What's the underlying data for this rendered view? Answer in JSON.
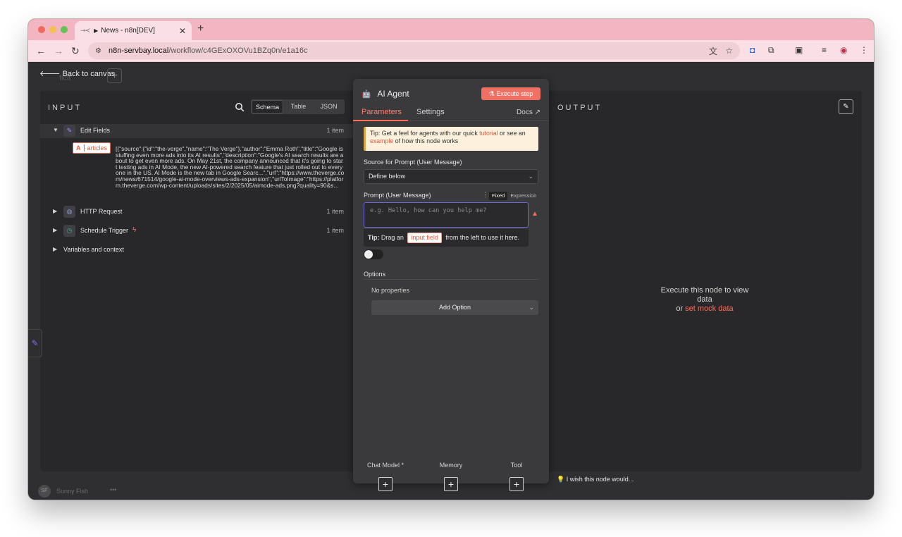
{
  "browser": {
    "tab_title": "News - n8n[DEV]",
    "tab_favicon": "⊸≺",
    "url_host": "n8n-servbay.local",
    "url_path": "/workflow/c4GExOXOVu1BZq0n/e1a16c"
  },
  "app": {
    "back_label": "Back to canvas",
    "ghost_node_name": "ficlt"
  },
  "input_panel": {
    "title": "INPUT",
    "view_modes": [
      "Schema",
      "Table",
      "JSON"
    ],
    "active_view": "Schema",
    "nodes": [
      {
        "name": "Edit Fields",
        "count": "1 item",
        "expanded": true
      },
      {
        "name": "HTTP Request",
        "count": "1 item"
      },
      {
        "name": "Schedule Trigger",
        "count": "1 item"
      },
      {
        "name": "Variables and context"
      }
    ],
    "field_type_letter": "A",
    "field_name": "articles",
    "field_value": "[{\"source\":{\"id\":\"the-verge\",\"name\":\"The Verge\"},\"author\":\"Emma Roth\",\"title\":\"Google is stuffing even more ads into its AI results\",\"description\":\"Google's AI search results are about to get even more ads. On May 21st, the company announced that it's going to start testing ads in AI Mode, the new AI-powered search feature that just rolled out to everyone in the US. AI Mode is the new tab in Google Searc...\",\"url\":\"https://www.theverge.com/news/671514/google-ai-mode-overviews-ads-expansion\",\"urlToImage\":\"https://platform.theverge.com/wp-content/uploads/sites/2/2025/05/aimode-ads.png?quality=90&s..."
  },
  "node_panel": {
    "title": "AI Agent",
    "execute_label": "Execute step",
    "tabs": [
      "Parameters",
      "Settings"
    ],
    "docs_label": "Docs",
    "notice_prefix": "Tip: Get a feel for agents with our quick ",
    "notice_link1": "tutorial",
    "notice_mid": " or see an ",
    "notice_link2": "example",
    "notice_suffix": " of how this node works",
    "source_label": "Source for Prompt (User Message)",
    "source_value": "Define below",
    "prompt_label": "Prompt (User Message)",
    "mode_fixed": "Fixed",
    "mode_expression": "Expression",
    "prompt_placeholder": "e.g. Hello, how can you help me?",
    "tip_prefix": "Tip:",
    "tip_drag": " Drag an ",
    "tip_chip": "input field",
    "tip_suffix": " from the left to use it here.",
    "options_title": "Options",
    "no_properties": "No properties",
    "add_option_label": "Add Option",
    "sub_nodes": [
      "Chat Model *",
      "Memory",
      "Tool"
    ]
  },
  "output_panel": {
    "title": "OUTPUT",
    "empty_msg": "Execute this node to view data",
    "or_text": "or ",
    "mock_link": "set mock data"
  },
  "footer": {
    "user_initials": "SF",
    "user_name": "Sunny Fish",
    "wish_text": "I wish this node would..."
  },
  "colors": {
    "accent": "#ff6d5a",
    "tab_strip": "#f2b5c1",
    "focus": "#6f68d9"
  }
}
